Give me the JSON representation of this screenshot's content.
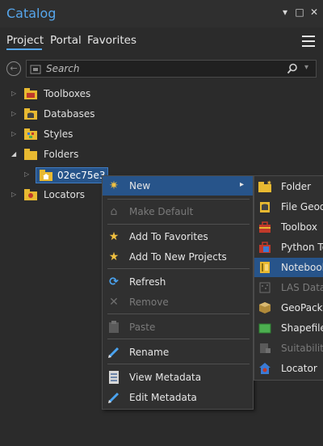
{
  "pane": {
    "title": "Catalog"
  },
  "window_buttons": {
    "dropdown": "▾",
    "maximize": "□",
    "close": "✕"
  },
  "tabs": [
    {
      "label": "Project"
    },
    {
      "label": "Portal"
    },
    {
      "label": "Favorites"
    }
  ],
  "search": {
    "placeholder": "Search"
  },
  "tree": {
    "items": [
      {
        "label": "Toolboxes",
        "icon": "toolbox-icon",
        "expanded": false
      },
      {
        "label": "Databases",
        "icon": "database-icon",
        "expanded": false
      },
      {
        "label": "Styles",
        "icon": "styles-icon",
        "expanded": false
      },
      {
        "label": "Folders",
        "icon": "folder-icon",
        "expanded": true
      },
      {
        "label": "Locators",
        "icon": "locator-icon",
        "expanded": false
      }
    ],
    "selected_folder": "02ec75e3-..."
  },
  "context_menu": {
    "items": [
      {
        "label": "New",
        "icon": "new-sparkle-icon",
        "enabled": true,
        "active": true
      },
      {
        "label": "Make Default",
        "icon": "home-icon",
        "enabled": false
      },
      {
        "label": "Add To Favorites",
        "icon": "star-icon",
        "enabled": true
      },
      {
        "label": "Add To New Projects",
        "icon": "star-icon",
        "enabled": true
      },
      {
        "label": "Refresh",
        "icon": "refresh-icon",
        "enabled": true
      },
      {
        "label": "Remove",
        "icon": "remove-icon",
        "enabled": false
      },
      {
        "label": "Paste",
        "icon": "paste-icon",
        "enabled": false
      },
      {
        "label": "Rename",
        "icon": "rename-pencil-icon",
        "enabled": true
      },
      {
        "label": "View Metadata",
        "icon": "metadata-icon",
        "enabled": true
      },
      {
        "label": "Edit Metadata",
        "icon": "edit-metadata-icon",
        "enabled": true
      }
    ],
    "submenu_arrow": "▸"
  },
  "submenu": {
    "items": [
      {
        "label": "Folder",
        "icon": "folder-icon",
        "enabled": true
      },
      {
        "label": "File Geod",
        "icon": "file-geodatabase-icon",
        "enabled": true
      },
      {
        "label": "Toolbox",
        "icon": "toolbox-icon",
        "enabled": true
      },
      {
        "label": "Python To",
        "icon": "python-toolbox-icon",
        "enabled": true
      },
      {
        "label": "Notebook",
        "icon": "notebook-icon",
        "enabled": true,
        "active": true
      },
      {
        "label": "LAS Datas",
        "icon": "las-dataset-icon",
        "enabled": false
      },
      {
        "label": "GeoPacka",
        "icon": "geopackage-icon",
        "enabled": true
      },
      {
        "label": "Shapefile",
        "icon": "shapefile-icon",
        "enabled": true
      },
      {
        "label": "Suitability",
        "icon": "suitability-icon",
        "enabled": false
      },
      {
        "label": "Locator",
        "icon": "locator-icon",
        "enabled": true
      }
    ]
  },
  "colors": {
    "accent": "#56a6ec",
    "selection": "#27548a",
    "folder": "#e8b931",
    "background": "#2b2b2b"
  }
}
